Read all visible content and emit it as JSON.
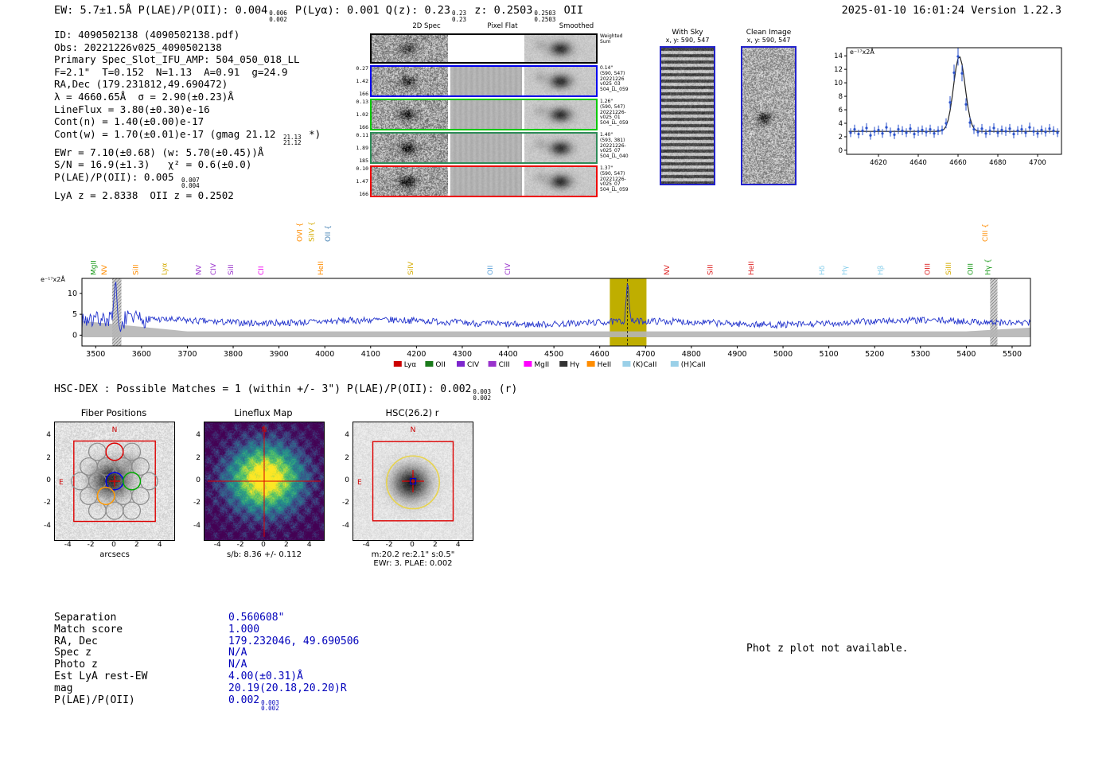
{
  "header": {
    "segments": [
      {
        "text": "EW: 5.7±1.5Å  P(LAE)/P(OII): 0.004"
      },
      {
        "stack": {
          "top": "0.006",
          "bot": "0.002"
        }
      },
      {
        "text": "  P(Lyα): 0.001  Q(z): 0.23"
      },
      {
        "stack": {
          "top": "0.23",
          "bot": "0.23"
        }
      },
      {
        "text": "  z: 0.2503"
      },
      {
        "stack": {
          "top": "0.2503",
          "bot": "0.2503"
        }
      },
      {
        "text": " OII"
      }
    ],
    "timestamp": "2025-01-10 16:01:24  Version 1.22.3"
  },
  "info": {
    "lines": [
      [
        {
          "text": "ID: 4090502138 (4090502138.pdf)"
        }
      ],
      [
        {
          "text": "Obs: 20221226v025_4090502138"
        }
      ],
      [
        {
          "text": "Primary Spec_Slot_IFU_AMP: 504_050_018_LL"
        }
      ],
      [
        {
          "text": "F=2.1\"  T=0.152  N=1.13  A=0.91  g=24.9"
        }
      ],
      [
        {
          "text": "RA,Dec (179.231812,49.690472)"
        }
      ],
      [
        {
          "text": "λ = 4660.65Å  σ = 2.90(±0.23)Å"
        }
      ],
      [
        {
          "text": "LineFlux = 3.80(±0.30)e-16"
        }
      ],
      [
        {
          "text": "Cont(n) = 1.40(±0.00)e-17"
        }
      ],
      [
        {
          "text": "Cont(w) = 1.70(±0.01)e-17 (gmag 21.12 "
        },
        {
          "stack": {
            "top": "21.13",
            "bot": "21.12"
          }
        },
        {
          "text": " *)"
        }
      ],
      [
        {
          "text": "EWr = 7.10(±0.68) (w: 5.70(±0.45))Å"
        }
      ],
      [
        {
          "text": "S/N = 16.9(±1.3)   χ² = 0.6(±0.0)"
        }
      ],
      [
        {
          "text": "P(LAE)/P(OII): 0.005 "
        },
        {
          "stack": {
            "top": "0.007",
            "bot": "0.004"
          }
        }
      ],
      [
        {
          "text": "LyA z = 2.8338  OII z = 0.2502"
        }
      ]
    ]
  },
  "spec2d": {
    "col_titles": [
      "2D Spec",
      "Pixel Flat",
      "Smoothed"
    ],
    "rows": [
      {
        "border": "#000000",
        "left": [],
        "right": [
          "Weighted",
          "Sum"
        ]
      },
      {
        "border": "#0000ee",
        "left": [
          "0.27",
          "1.42",
          "166"
        ],
        "right": [
          "0.14\"",
          "(590, 547)",
          "20221226",
          "v025_03",
          "504_LL_059"
        ]
      },
      {
        "border": "#00c800",
        "left": [
          "0.13",
          "1.02",
          "166"
        ],
        "right": [
          "1.26\"",
          "(590, 547)",
          "20221226-",
          "v025_01",
          "504_LL_059"
        ]
      },
      {
        "border": "#2e8b57",
        "left": [
          "0.11",
          "1.89",
          "185"
        ],
        "right": [
          "1.40\"",
          "(593, 381)",
          "20221226-",
          "v025_07",
          "504_LL_040"
        ]
      },
      {
        "border": "#ee0000",
        "left": [
          "0.10",
          "1.47",
          "166"
        ],
        "right": [
          "1.37\"",
          "(590, 547)",
          "20221226-",
          "v025_07",
          "504_LL_059"
        ]
      }
    ]
  },
  "stamps": {
    "with_sky": {
      "title": "With Sky",
      "subtitle": "x, y: 590, 547"
    },
    "clean": {
      "title": "Clean Image",
      "subtitle": "x, y: 590, 547"
    }
  },
  "chart_data": [
    {
      "id": "line_fit_zoom",
      "type": "scatter",
      "title": "emission line fit cutout",
      "ylabel": "e⁻¹⁷x2Å",
      "xlim": [
        4604,
        4712
      ],
      "ylim": [
        -0.6,
        15.2
      ],
      "x_ticks": [
        4620,
        4640,
        4660,
        4680,
        4700
      ],
      "y_ticks": [
        0,
        2,
        4,
        6,
        8,
        10,
        12,
        14
      ],
      "x_start": 4606,
      "x_step": 2,
      "values": [
        2.6,
        3.1,
        2.4,
        2.9,
        3.3,
        2.2,
        2.8,
        3.0,
        2.5,
        3.4,
        2.7,
        2.3,
        3.1,
        2.9,
        2.6,
        3.2,
        2.4,
        2.8,
        3.0,
        2.7,
        3.1,
        2.5,
        2.9,
        3.0,
        4.0,
        7.1,
        11.5,
        13.9,
        11.4,
        6.8,
        4.1,
        3.1,
        2.7,
        3.2,
        2.5,
        2.9,
        3.3,
        2.6,
        3.0,
        2.8,
        3.2,
        2.4,
        2.9,
        3.1,
        2.6,
        3.4,
        2.8,
        2.5,
        3.0,
        2.7,
        3.2,
        2.9,
        2.6
      ],
      "yerr_base": 0.5,
      "yerr_scale": 0.06,
      "fit": {
        "continuum": 2.8,
        "amplitude": 11.1,
        "center": 4660.65,
        "sigma": 2.9
      },
      "marker_color": "#2a52cc",
      "fit_color": "#222222"
    },
    {
      "id": "full_spectrum",
      "type": "line",
      "title": "full HETDEX spectrum",
      "ylabel": "e⁻¹⁷x2Å",
      "xlim": [
        3470,
        5540
      ],
      "ylim": [
        -2.6,
        13.6
      ],
      "x_ticks": [
        3500,
        3600,
        3700,
        3800,
        3900,
        4000,
        4100,
        4200,
        4300,
        4400,
        4500,
        4600,
        4700,
        4800,
        4900,
        5000,
        5100,
        5200,
        5300,
        5400,
        5500
      ],
      "y_ticks": [
        0,
        5,
        10
      ],
      "line_color": "#2233cc",
      "continuum": 3.2,
      "noise_amp": 0.8,
      "emission_line": {
        "center": 4660.65,
        "peak_above_continuum": 9.6,
        "sigma": 2.9
      },
      "artifacts": [
        {
          "x": 3544,
          "amp": 8.0,
          "sigma": 3
        },
        {
          "x": 3553,
          "amp": -4.5,
          "sigma": 3
        }
      ],
      "highlight_band": {
        "x0": 4622,
        "x1": 4702,
        "color": "#bfae00"
      },
      "hatched_bands": [
        [
          3536,
          3556
        ],
        [
          5452,
          5468
        ]
      ],
      "error_band": {
        "mid": 0.9,
        "left_edge": 3.4,
        "left_until": 3700,
        "right_rise": 0.9,
        "right_from": 5400,
        "color": "#b5b5b5"
      },
      "line_labels": [
        {
          "name": "MgII",
          "wl": 3500,
          "color": "#1a9a1a",
          "row": 0
        },
        {
          "name": "NV",
          "wl": 3524,
          "color": "#ff8c00",
          "row": 0
        },
        {
          "name": "SiII",
          "wl": 3592,
          "color": "#ff8c00",
          "row": 0
        },
        {
          "name": "Lyα",
          "wl": 3655,
          "color": "#d4aa00",
          "row": 0
        },
        {
          "name": "NV",
          "wl": 3730,
          "color": "#9932cc",
          "row": 0
        },
        {
          "name": "CIV",
          "wl": 3762,
          "color": "#9932cc",
          "row": 0
        },
        {
          "name": "SiII",
          "wl": 3800,
          "color": "#9932cc",
          "row": 0
        },
        {
          "name": "CII",
          "wl": 3866,
          "color": "#ee00ee",
          "row": 0
        },
        {
          "name": "OVI {",
          "wl": 3950,
          "color": "#ff8c00",
          "row": 1
        },
        {
          "name": "SiIV {",
          "wl": 3976,
          "color": "#d4aa00",
          "row": 1
        },
        {
          "name": "OII {",
          "wl": 4012,
          "color": "#4682b4",
          "row": 1
        },
        {
          "name": "HeII",
          "wl": 3996,
          "color": "#ff8c00",
          "row": 0
        },
        {
          "name": "SiIV",
          "wl": 4192,
          "color": "#d4aa00",
          "row": 0
        },
        {
          "name": "OII",
          "wl": 4366,
          "color": "#5aa0d8",
          "row": 0
        },
        {
          "name": "CIV",
          "wl": 4404,
          "color": "#9932cc",
          "row": 0
        },
        {
          "name": "NV",
          "wl": 4752,
          "color": "#dd2222",
          "row": 0
        },
        {
          "name": "SiII",
          "wl": 4846,
          "color": "#dd2222",
          "row": 0
        },
        {
          "name": "HeII",
          "wl": 4936,
          "color": "#dd2222",
          "row": 0
        },
        {
          "name": "Hδ",
          "wl": 5090,
          "color": "#87ceeb",
          "row": 0
        },
        {
          "name": "Hγ",
          "wl": 5140,
          "color": "#87ceeb",
          "row": 0
        },
        {
          "name": "Hβ",
          "wl": 5218,
          "color": "#87ceeb",
          "row": 0
        },
        {
          "name": "OIII",
          "wl": 5320,
          "color": "#dd2222",
          "row": 0
        },
        {
          "name": "SiIII",
          "wl": 5366,
          "color": "#d4aa00",
          "row": 0
        },
        {
          "name": "OIII",
          "wl": 5414,
          "color": "#1a9a1a",
          "row": 0
        },
        {
          "name": "Hγ {",
          "wl": 5452,
          "color": "#1a9a1a",
          "row": 0
        },
        {
          "name": "CIII {",
          "wl": 5446,
          "color": "#ff8c00",
          "row": 1
        }
      ],
      "legend": [
        {
          "label": "Lyα",
          "color": "#cc0000"
        },
        {
          "label": "OII",
          "color": "#1a7a1a"
        },
        {
          "label": "CIV",
          "color": "#7d26cd"
        },
        {
          "label": "CIII",
          "color": "#9932cc"
        },
        {
          "label": "MgII",
          "color": "#ff00ff"
        },
        {
          "label": "Hγ",
          "color": "#333333"
        },
        {
          "label": "HeII",
          "color": "#ff8c00"
        },
        {
          "label": "(K)CaII",
          "color": "#9ad0e8"
        },
        {
          "label": "(H)CaII",
          "color": "#9ad0e8"
        }
      ]
    }
  ],
  "cutouts": {
    "match_line": {
      "segments": [
        {
          "text": "HSC-DEX : Possible Matches = 1 (within +/- 3\")  P(LAE)/P(OII): 0.002"
        },
        {
          "stack": {
            "top": "0.003",
            "bot": "0.002"
          }
        },
        {
          "text": " (r)"
        }
      ]
    },
    "panels": [
      {
        "title": "Fiber Positions",
        "xlabel": "arcsecs",
        "ticks": [
          -4,
          -2,
          0,
          2,
          4
        ],
        "north": "N",
        "east": "E"
      },
      {
        "title": "Lineflux Map",
        "caption": "s/b: 8.36 +/- 0.112",
        "ticks": [
          -4,
          -2,
          0,
          2,
          4
        ],
        "north": "N"
      },
      {
        "title": "HSC(26.2) r",
        "caption": "m:20.2 re:2.1\" s:0.5\"",
        "caption2": "EWr: 3. PLAE: 0.002",
        "ticks": [
          -4,
          -2,
          0,
          2,
          4
        ],
        "north": "N",
        "east": "E"
      }
    ]
  },
  "match_table": {
    "rows": [
      {
        "label": "Separation",
        "value": "0.560608\""
      },
      {
        "label": "Match score",
        "value": "1.000"
      },
      {
        "label": "RA, Dec",
        "value": "179.232046, 49.690506"
      },
      {
        "label": "Spec z",
        "value": "N/A"
      },
      {
        "label": "Photo z",
        "value": "N/A"
      },
      {
        "label": "Est LyA rest-EW",
        "value": "4.00(±0.31)Å"
      },
      {
        "label": "mag",
        "value": "20.19(20.18,20.20)R"
      },
      {
        "label": "P(LAE)/P(OII)",
        "value": "0.002",
        "top": "0.003",
        "bot": "0.002"
      }
    ]
  },
  "photz_note": "Phot z plot not available."
}
